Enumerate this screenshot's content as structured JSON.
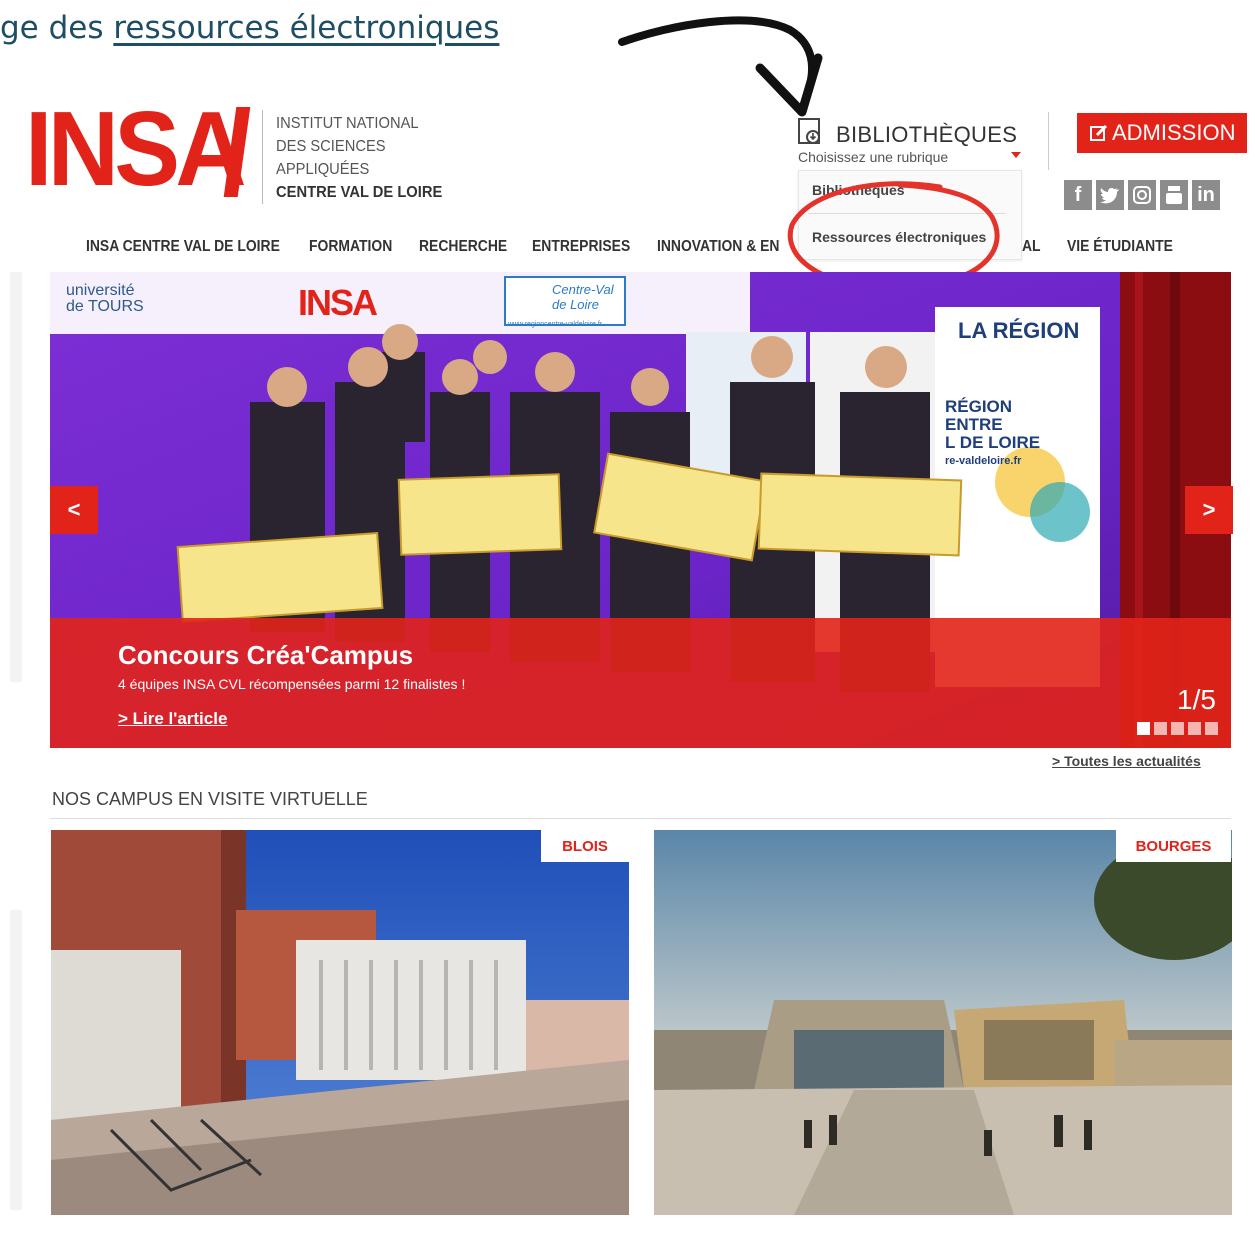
{
  "caption": {
    "prefix": "ge des ",
    "link": "ressources électroniques"
  },
  "logo": {
    "word": "INSA",
    "line1": "INSTITUT NATIONAL",
    "line2": "DES SCIENCES",
    "line3": "APPLIQUÉES",
    "line4": "CENTRE VAL DE LOIRE"
  },
  "bibliotheques": {
    "title": "BIBLIOTHÈQUES",
    "select_placeholder": "Choisissez une rubrique",
    "options": [
      "Bibliothèques",
      "Ressources électroniques"
    ]
  },
  "admission": "ADMISSION",
  "social": [
    "f",
    "t",
    "o",
    "y",
    "in"
  ],
  "nav": [
    "INSA CENTRE VAL DE LOIRE",
    "FORMATION",
    "RECHERCHE",
    "ENTREPRISES",
    "INNOVATION & ENT",
    "AL",
    "VIE ÉTUDIANTE"
  ],
  "hero": {
    "title": "Concours Créa'Campus",
    "description": "4 équipes INSA CVL récompensées parmi 12 finalistes !",
    "link": "> Lire l'article",
    "counter": "1/5",
    "active_slide": 1,
    "total_slides": 5,
    "prev": "<",
    "next": ">",
    "photo_text": {
      "univ": "université de TOURS",
      "insa": "INSA",
      "region_logo": "Centre-Val de Loire",
      "region_url": "www.regioncentre-valdeloire.fr",
      "banner_title": "LA RÉGION",
      "banner_lines": [
        "RÉGION",
        "ENTRE",
        "L DE LOIRE",
        "re-valdeloire.fr"
      ]
    }
  },
  "news_link": "> Toutes les actualités",
  "campus": {
    "title": "NOS CAMPUS EN VISITE VIRTUELLE",
    "tiles": [
      {
        "tag": "BLOIS"
      },
      {
        "tag": "BOURGES"
      }
    ]
  },
  "colors": {
    "accent": "#e2231a",
    "caption": "#1d4e63",
    "nav": "#333333"
  }
}
